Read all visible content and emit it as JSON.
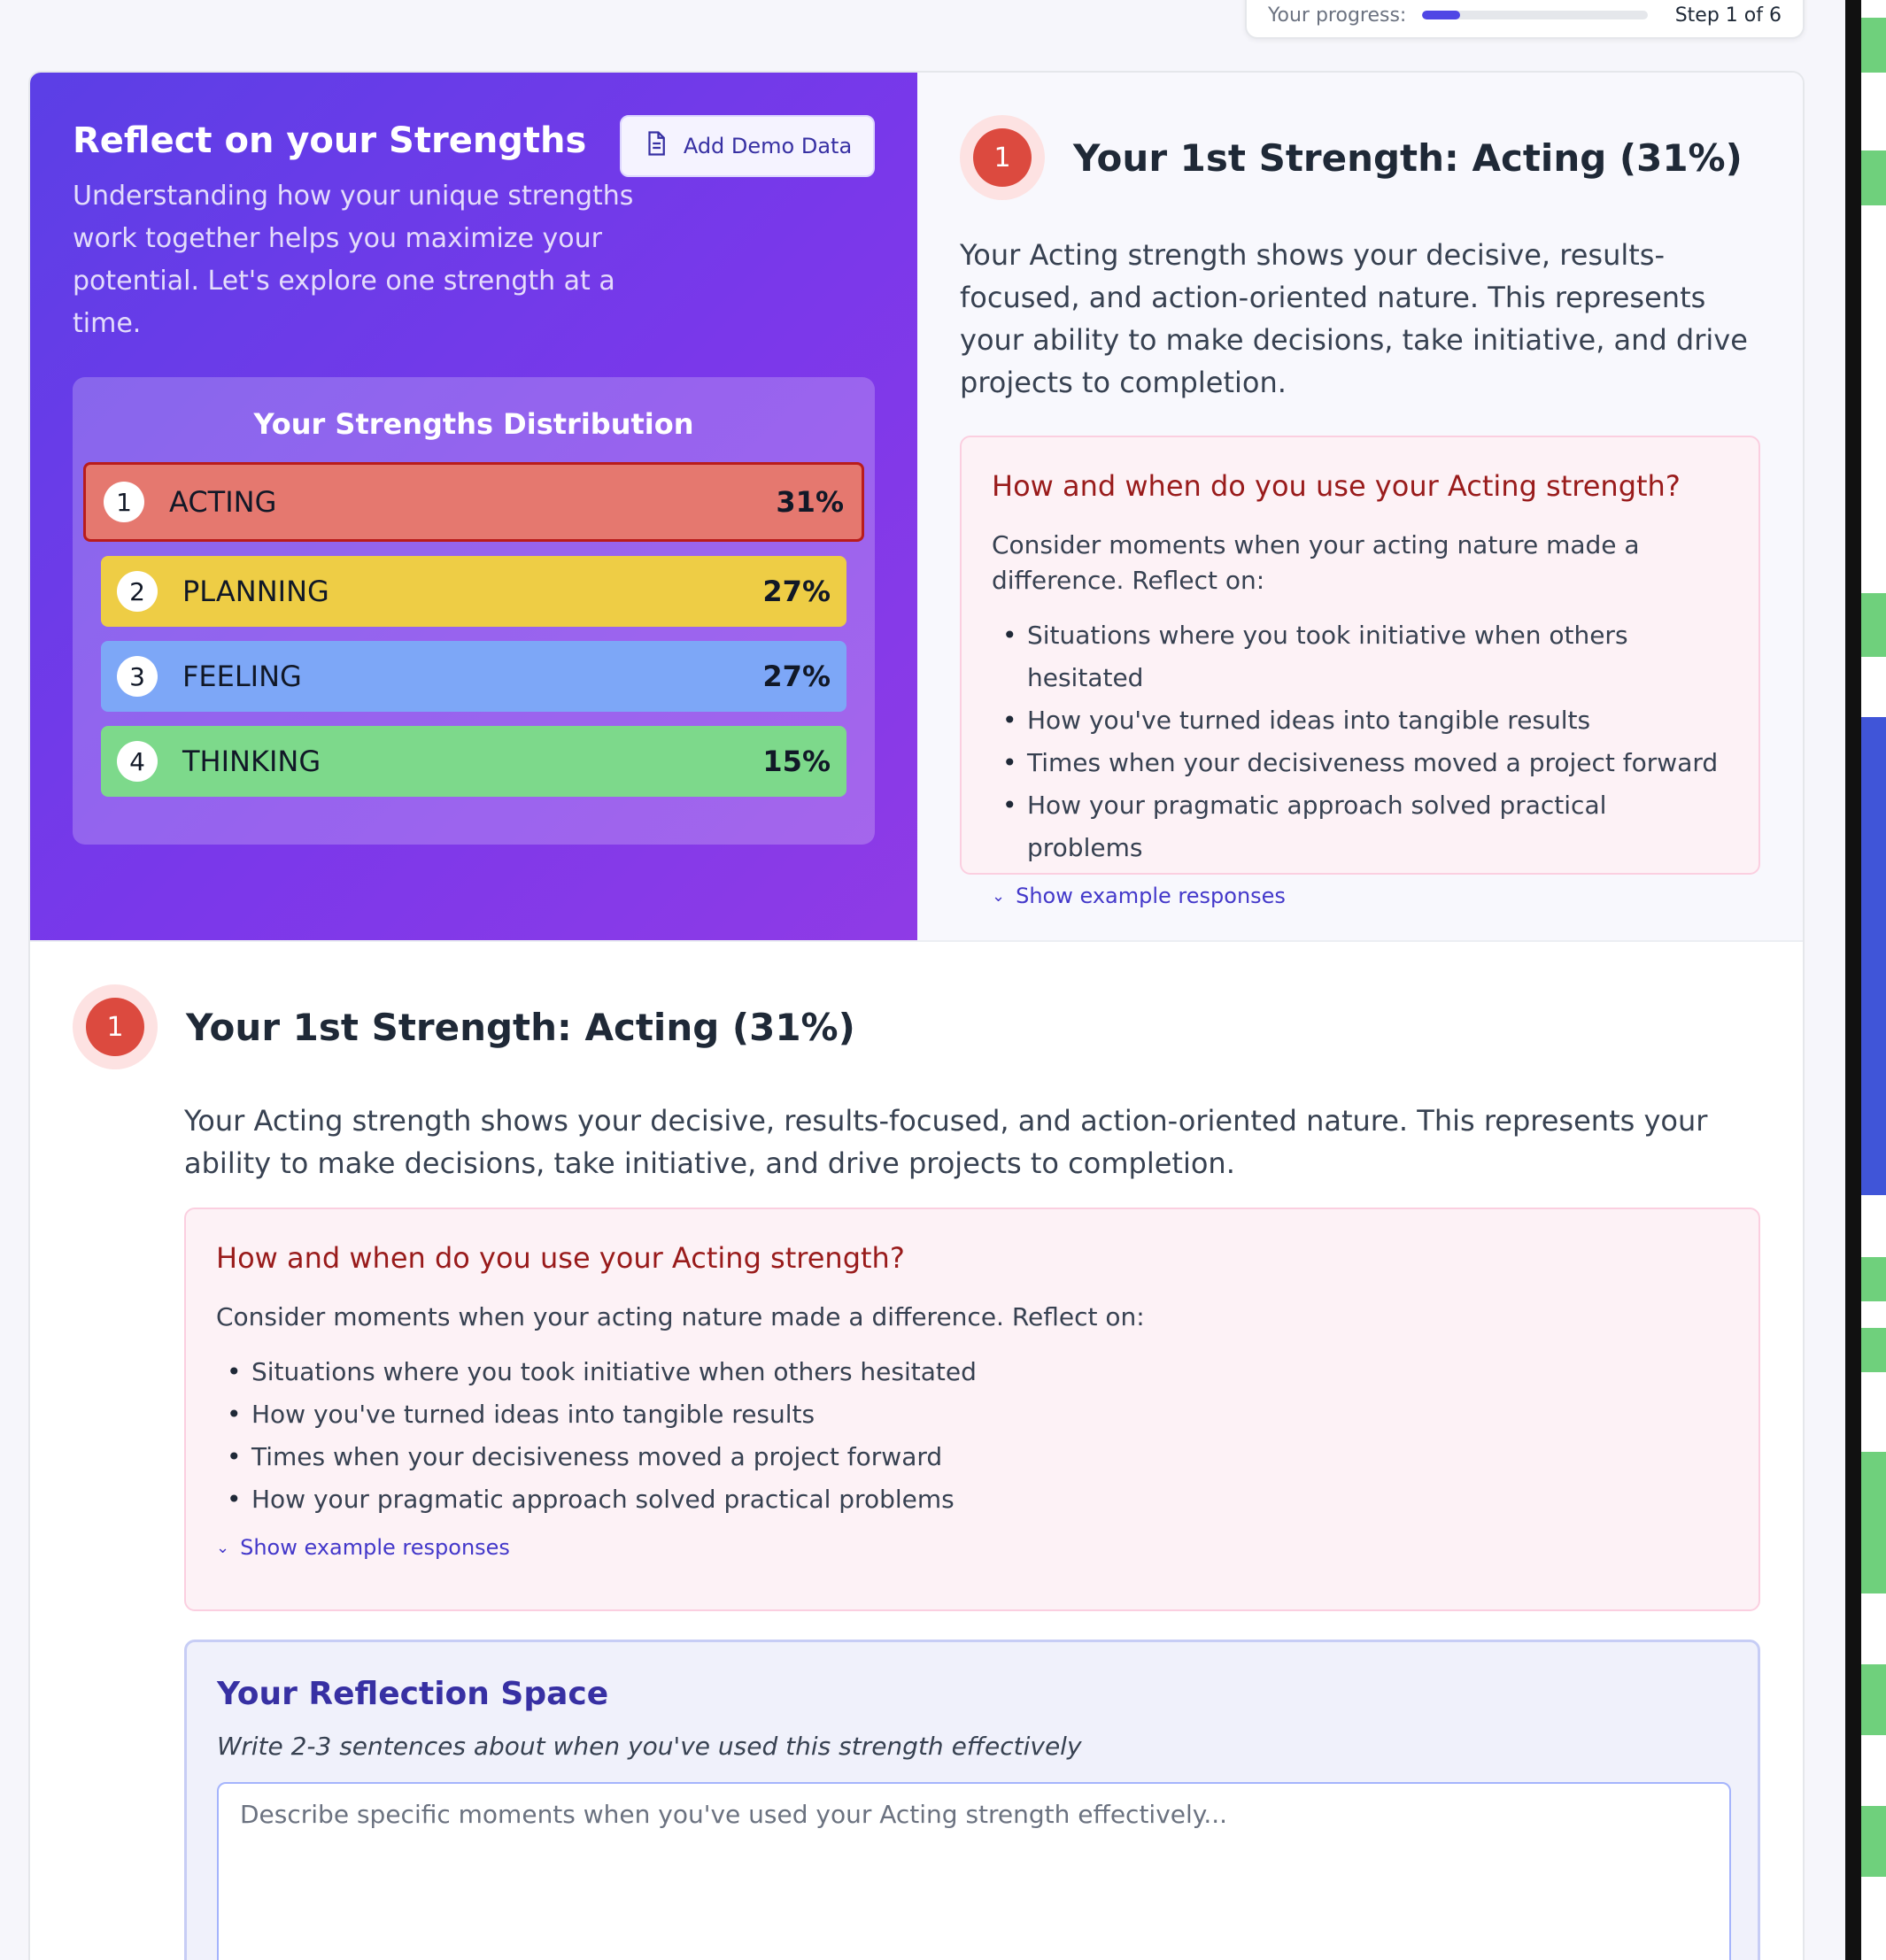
{
  "progress": {
    "label": "Your progress:",
    "step_text": "Step 1 of 6",
    "fraction": 0.1667
  },
  "hero": {
    "title": "Reflect on your Strengths",
    "intro": "Understanding how your unique strengths work together helps you maximize your potential. Let's explore one strength at a time.",
    "demo_button": "Add Demo Data",
    "distribution_title": "Your Strengths Distribution",
    "strengths": [
      {
        "rank": "1",
        "name": "ACTING",
        "pct": "31%",
        "color": "#e5786f"
      },
      {
        "rank": "2",
        "name": "PLANNING",
        "pct": "27%",
        "color": "#eecd45"
      },
      {
        "rank": "3",
        "name": "FEELING",
        "pct": "27%",
        "color": "#7da7f7"
      },
      {
        "rank": "4",
        "name": "THINKING",
        "pct": "15%",
        "color": "#7dd98b"
      }
    ]
  },
  "strength_card": {
    "number": "1",
    "heading": "Your 1st Strength: Acting (31%)",
    "description": "Your Acting strength shows your decisive, results-focused, and action-oriented nature. This represents your ability to make decisions, take initiative, and drive projects to completion.",
    "question": "How and when do you use your Acting strength?",
    "consider": "Consider moments when your acting nature made a difference. Reflect on:",
    "bullets": [
      "Situations where you took initiative when others hesitated",
      "How you've turned ideas into tangible results",
      "Times when your decisiveness moved a project forward",
      "How your pragmatic approach solved practical problems"
    ],
    "show_examples": "Show example responses"
  },
  "reflection": {
    "title": "Your Reflection Space",
    "hint": "Write 2-3 sentences about when you've used this strength effectively",
    "placeholder": "Describe specific moments when you've used your Acting strength effectively..."
  },
  "colors": {
    "accent": "#4f46e5",
    "hero_gradient_start": "#5b3fe6",
    "hero_gradient_end": "#8f3be6",
    "acting_red": "#dc4a3f"
  }
}
